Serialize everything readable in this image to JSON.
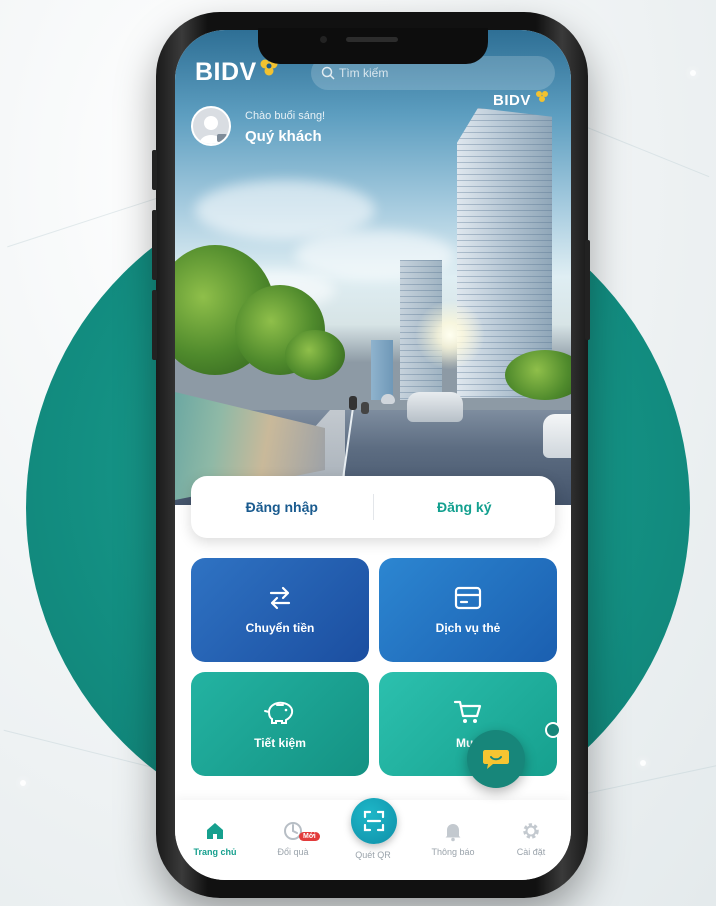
{
  "app": {
    "brand": "BIDV",
    "building_sign": "BIDV"
  },
  "header": {
    "search_placeholder": "Tìm kiếm",
    "greeting": "Chào buổi sáng!",
    "user_name": "Quý khách"
  },
  "auth": {
    "login_label": "Đăng nhập",
    "register_label": "Đăng ký"
  },
  "tiles": [
    {
      "label": "Chuyển tiền",
      "icon": "transfer-arrows-icon"
    },
    {
      "label": "Dịch vụ thẻ",
      "icon": "card-icon"
    },
    {
      "label": "Tiết kiệm",
      "icon": "piggy-bank-icon"
    },
    {
      "label": "Mua",
      "icon": "shopping-cart-icon"
    }
  ],
  "bottom_nav": [
    {
      "label": "Trang chủ",
      "icon": "home-icon",
      "active": true
    },
    {
      "label": "Đổi quà",
      "icon": "gift-icon",
      "badge": "Mới"
    },
    {
      "label": "Quét QR",
      "icon": "qr-scan-icon"
    },
    {
      "label": "Thông báo",
      "icon": "bell-icon"
    },
    {
      "label": "Cài đặt",
      "icon": "gear-icon"
    }
  ],
  "colors": {
    "teal": "#16a08e",
    "blue": "#1a5b8f",
    "badge_red": "#e23b3b"
  }
}
